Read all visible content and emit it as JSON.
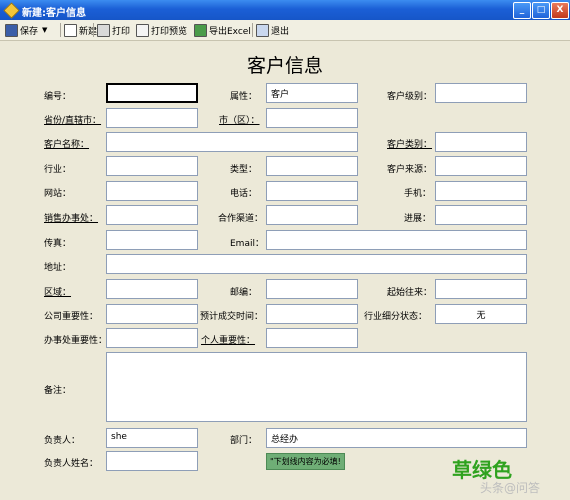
{
  "window": {
    "title": "新建:客户信息",
    "minimize": "_",
    "maximize": "□",
    "close": "X"
  },
  "toolbar": {
    "save": "保存",
    "new": "新建",
    "print": "打印",
    "print_preview": "打印预览",
    "export_excel": "导出Excel",
    "exit": "退出"
  },
  "form": {
    "title": "客户信息",
    "labels": {
      "code": "编号：",
      "attribute": "属性：",
      "customer_level": "客户级别：",
      "province": "省份/直辖市：",
      "city": "市（区）：",
      "customer_name": "客户名称：",
      "customer_type": "客户类别：",
      "industry": "行业：",
      "category": "类型：",
      "customer_source": "客户来源：",
      "website": "网站：",
      "phone": "电话：",
      "mobile": "手机：",
      "sales_office": "销售办事处：",
      "channel": "合作渠道：",
      "progress": "进展：",
      "fax": "传真：",
      "email": "Email：",
      "address": "地址：",
      "region": "区域：",
      "postcode": "邮编：",
      "start_contact": "起始往来：",
      "company_importance": "公司重要性：",
      "expected_time": "预计成交时间：",
      "industry_status": "行业细分状态：",
      "office_importance": "办事处重要性：",
      "personal_importance": "个人重要性：",
      "remarks": "备注：",
      "owner": "负责人：",
      "department": "部门：",
      "owner_name": "负责人姓名："
    },
    "values": {
      "attribute": "客户",
      "industry_status": "无",
      "owner": "she",
      "department": "总经办"
    },
    "required_note": "\"下划线内容为必填!"
  },
  "watermark": {
    "brand": "草绿色",
    "sub": "头条@问答"
  }
}
